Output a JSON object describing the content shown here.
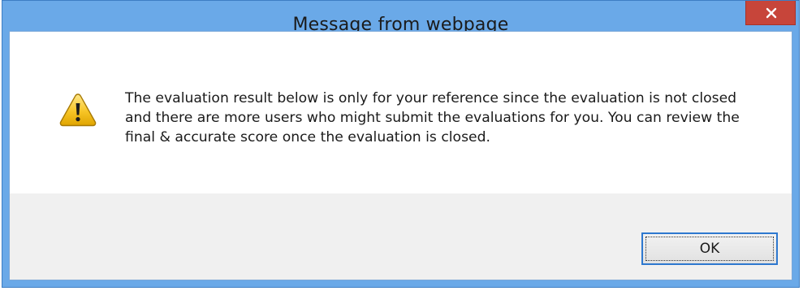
{
  "window": {
    "title": "Message from webpage",
    "close_icon": "close-icon",
    "frame_color": "#6aa9e8",
    "close_color": "#c7453a"
  },
  "message": {
    "icon": "warning-icon",
    "text": "The evaluation result below is only for your reference since the evaluation is not closed and there are more users who might submit the evaluations for you. You can review the final & accurate score once the evaluation is closed."
  },
  "buttons": {
    "ok_label": "OK"
  }
}
